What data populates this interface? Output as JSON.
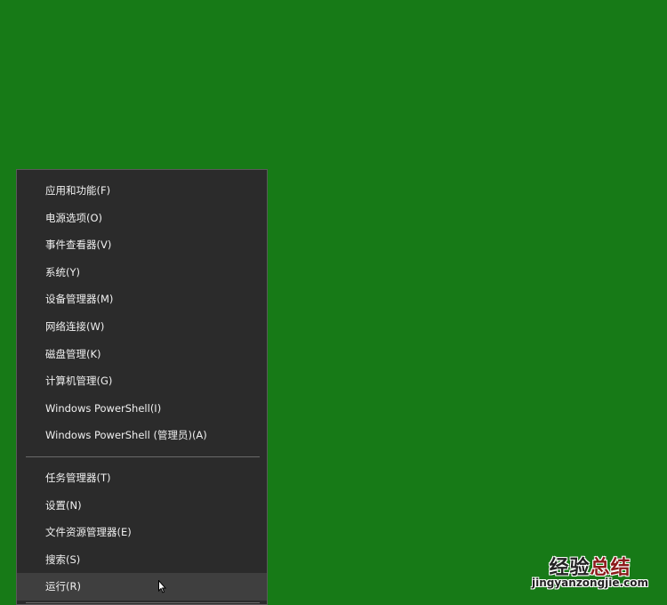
{
  "menu": {
    "group1": [
      "应用和功能(F)",
      "电源选项(O)",
      "事件查看器(V)",
      "系统(Y)",
      "设备管理器(M)",
      "网络连接(W)",
      "磁盘管理(K)",
      "计算机管理(G)",
      "Windows PowerShell(I)",
      "Windows PowerShell (管理员)(A)"
    ],
    "group2": [
      "任务管理器(T)",
      "设置(N)",
      "文件资源管理器(E)",
      "搜索(S)",
      "运行(R)"
    ],
    "hovered": "运行(R)"
  },
  "watermark": {
    "cn_black": "经验",
    "cn_red": "总结",
    "url": "jingyanzongjie.com"
  },
  "colors": {
    "desktop": "#177a17",
    "menu_bg": "#2b2b2b",
    "hover_bg": "#3f3f3f"
  }
}
